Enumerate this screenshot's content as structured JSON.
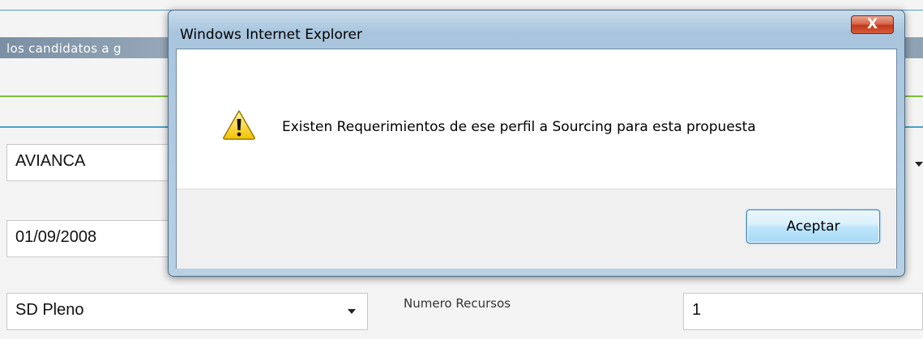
{
  "background": {
    "banner_text": "los candidatos a g",
    "client_field": "AVIANCA",
    "date_field": "01/09/2008",
    "profile_select": "SD Pleno",
    "resources_label": "Numero Recursos",
    "resources_value": "1"
  },
  "dialog": {
    "title": "Windows Internet Explorer",
    "close_symbol": "X",
    "message": "Existen Requerimientos de ese perfil a Sourcing para esta propuesta",
    "ok_label": "Aceptar",
    "icon": "warning-icon"
  },
  "colors": {
    "dialog_frame": "#b7d0e4",
    "close_button": "#c2381a",
    "accent_green": "#7fbf3a",
    "accent_blue": "#4aa3c3"
  }
}
